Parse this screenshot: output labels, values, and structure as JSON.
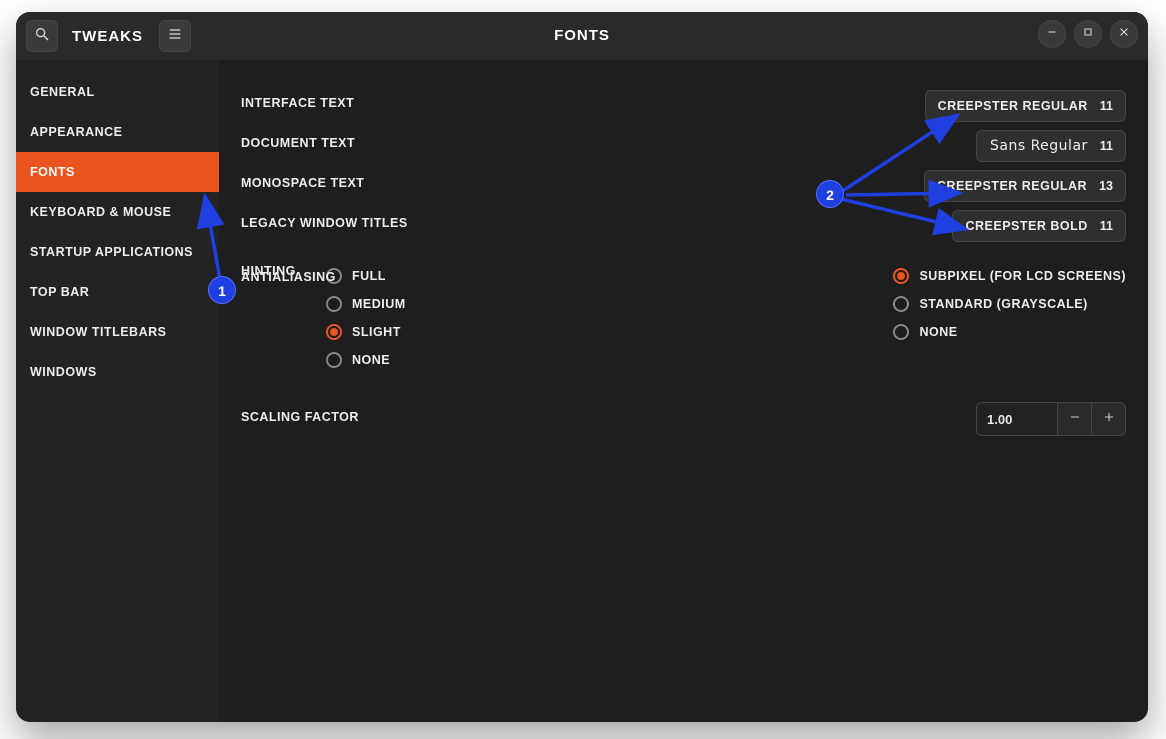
{
  "header": {
    "app_title": "Tweaks",
    "panel_title": "Fonts"
  },
  "sidebar": {
    "items": [
      {
        "label": "General",
        "active": false
      },
      {
        "label": "Appearance",
        "active": false
      },
      {
        "label": "Fonts",
        "active": true
      },
      {
        "label": "Keyboard & Mouse",
        "active": false
      },
      {
        "label": "Startup Applications",
        "active": false
      },
      {
        "label": "Top Bar",
        "active": false
      },
      {
        "label": "Window Titlebars",
        "active": false
      },
      {
        "label": "Windows",
        "active": false
      }
    ]
  },
  "fonts": {
    "rows": [
      {
        "label": "Interface Text",
        "font": "Creepster Regular",
        "size": "11",
        "sans": false
      },
      {
        "label": "Document Text",
        "font": "Sans Regular",
        "size": "11",
        "sans": true
      },
      {
        "label": "Monospace Text",
        "font": "Creepster Regular",
        "size": "13",
        "sans": false
      },
      {
        "label": "Legacy Window Titles",
        "font": "Creepster Bold",
        "size": "11",
        "sans": false
      }
    ]
  },
  "hinting": {
    "label": "Hinting",
    "options": [
      {
        "label": "Full",
        "checked": false
      },
      {
        "label": "Medium",
        "checked": false
      },
      {
        "label": "Slight",
        "checked": true
      },
      {
        "label": "None",
        "checked": false
      }
    ]
  },
  "antialiasing": {
    "label": "Antialiasing",
    "options": [
      {
        "label": "Subpixel (for LCD screens)",
        "checked": true
      },
      {
        "label": "Standard (grayscale)",
        "checked": false
      },
      {
        "label": "None",
        "checked": false
      }
    ]
  },
  "scaling": {
    "label": "Scaling Factor",
    "value": "1.00"
  },
  "callouts": {
    "one": "1",
    "two": "2"
  }
}
